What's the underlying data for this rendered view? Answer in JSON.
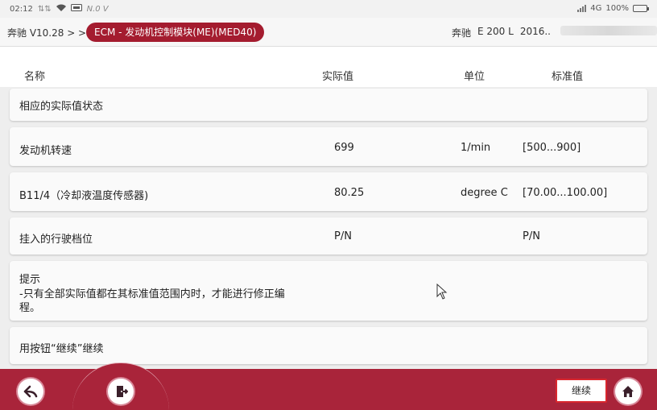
{
  "status_bar": {
    "time": "02:12",
    "left_extra": "N.0 V",
    "network": "4G",
    "battery": "100%"
  },
  "header": {
    "breadcrumb_root": "奔驰 V10.28 > >",
    "breadcrumb_current": "ECM - 发动机控制模块(ME)(MED40)",
    "vehicle_brand": "奔驰",
    "vehicle_model": "E 200 L",
    "vehicle_year": "2016.."
  },
  "columns": {
    "name": "名称",
    "actual": "实际值",
    "unit": "单位",
    "standard": "标准值"
  },
  "rows": [
    {
      "name": "相应的实际值状态",
      "actual": "",
      "unit": "",
      "standard": ""
    },
    {
      "name": "发动机转速",
      "actual": "699",
      "unit": "1/min",
      "standard": "[500...900]"
    },
    {
      "name": "B11/4（冷却液温度传感器)",
      "actual": "80.25",
      "unit": "degree C",
      "standard": "[70.00...100.00]"
    },
    {
      "name": "挂入的行驶档位",
      "actual": "P/N",
      "unit": "",
      "standard": "P/N"
    }
  ],
  "hint": {
    "title": "提示",
    "line1": "-只有全部实际值都在其标准值范围内时，才能进行修正编",
    "line2": "程。"
  },
  "instruction": "用按钮“继续”继续",
  "bottom_bar": {
    "continue_label": "继续",
    "back_icon": "back-arrow-icon",
    "exit_icon": "exit-door-icon",
    "home_icon": "home-icon"
  }
}
